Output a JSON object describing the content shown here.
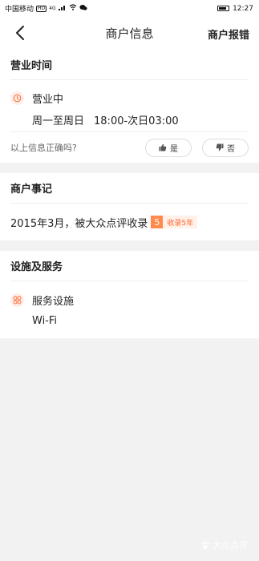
{
  "statusbar": {
    "carrier": "中国移动",
    "hd_badge": "HD",
    "network": "4G",
    "time": "12:27"
  },
  "navbar": {
    "title": "商户信息",
    "report": "商户报错"
  },
  "hours_section": {
    "title": "营业时间",
    "status": "营业中",
    "days": "周一至周日",
    "time_range": "18:00-次日03:00",
    "question": "以上信息正确吗?",
    "yes_label": "是",
    "no_label": "否"
  },
  "record_section": {
    "title": "商户事记",
    "text": "2015年3月，被大众点评收录",
    "badge_number": "5",
    "badge_label": "收录5年"
  },
  "facility_section": {
    "title": "设施及服务",
    "label": "服务设施",
    "value": "Wi-Fi"
  },
  "watermark": {
    "text": "大众点评"
  },
  "colors": {
    "accent": "#ff6633",
    "icon_bg": "#fdeee7",
    "background": "#f2f2f2"
  },
  "icons": {
    "back": "chevron-left-icon",
    "clock": "clock-icon",
    "thumb_up": "thumbs-up-icon",
    "thumb_down": "thumbs-down-icon",
    "facility": "grid-icon"
  }
}
